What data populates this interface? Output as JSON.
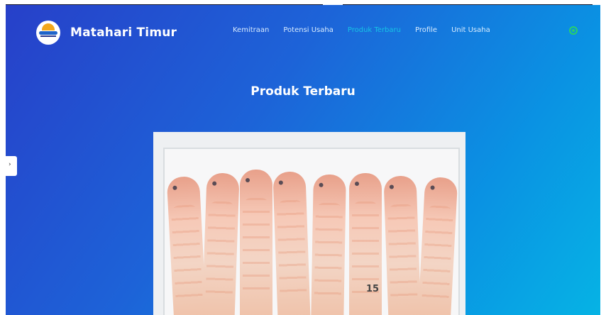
{
  "brand": {
    "name": "Matahari Timur"
  },
  "nav": {
    "items": [
      "Kemitraan",
      "Potensi Usaha",
      "Produk Terbaru",
      "Profile",
      "Unit Usaha"
    ],
    "active_index": 2
  },
  "icons": {
    "whatsapp": "whatsapp-icon",
    "side": "chevron-right-icon"
  },
  "colors": {
    "accent": "#16c4e6",
    "whatsapp": "#28d06a"
  },
  "section": {
    "title": "Produk Terbaru"
  },
  "photo": {
    "label": "15"
  }
}
